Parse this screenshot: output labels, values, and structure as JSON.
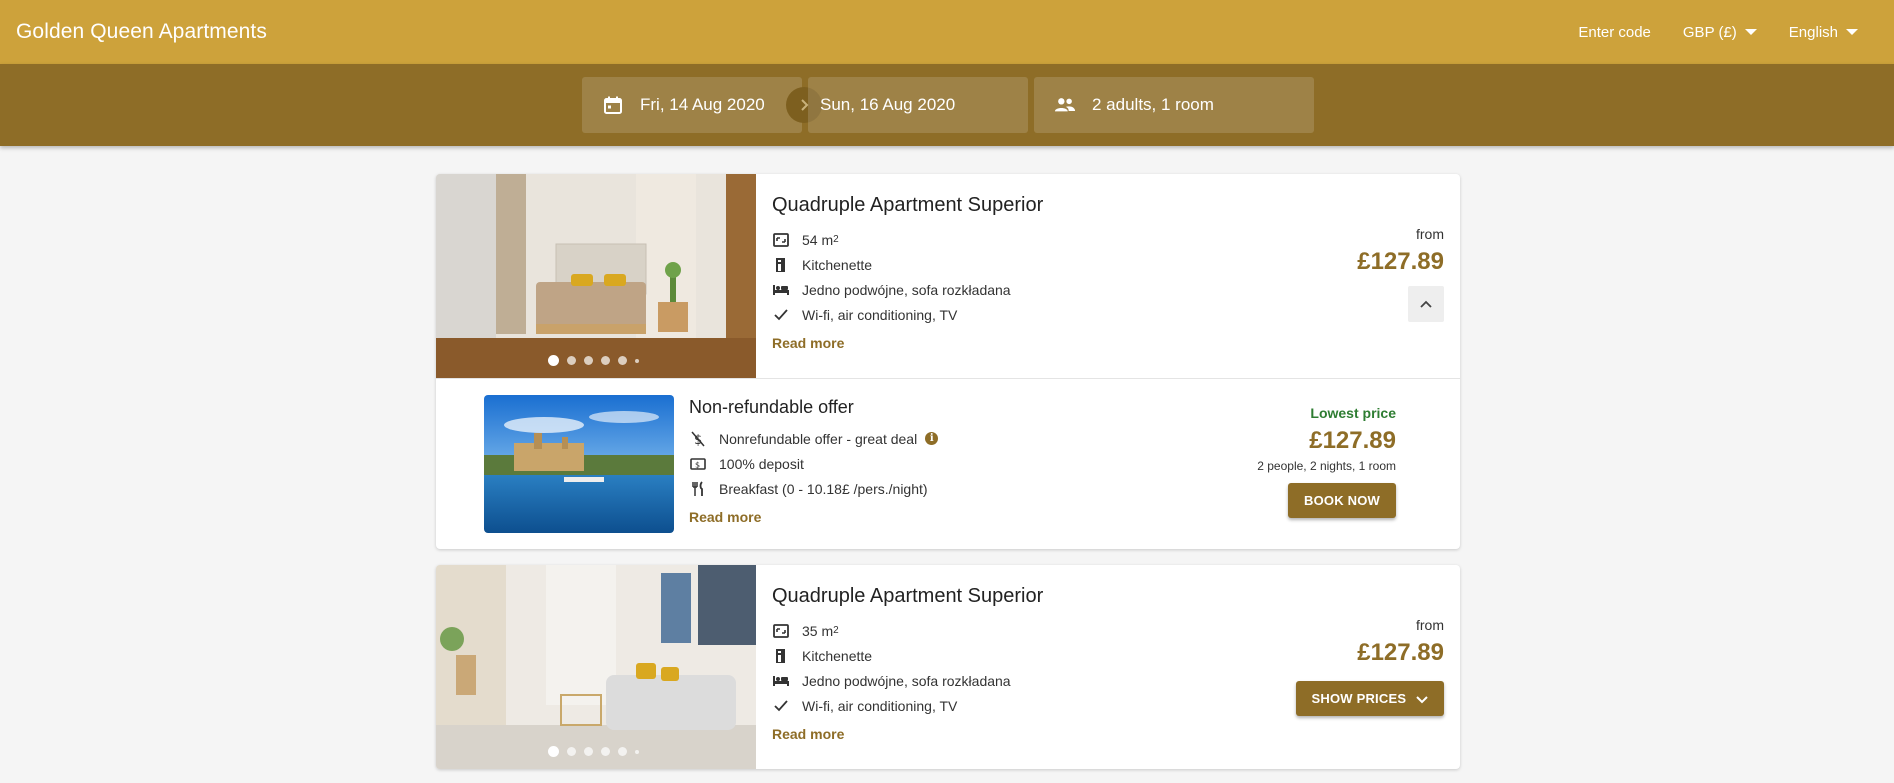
{
  "header": {
    "brand": "Golden Queen Apartments",
    "enter_code": "Enter code",
    "currency": "GBP (£)",
    "language": "English",
    "bg_color": "#cda23b"
  },
  "search": {
    "check_in": "Fri, 14 Aug 2020",
    "check_out": "Sun, 16 Aug 2020",
    "guests": "2 adults, 1 room",
    "bg_color": "#8e6d27"
  },
  "rooms": [
    {
      "title": "Quadruple Apartment Superior",
      "area": "54 m",
      "area_sup": "2",
      "kitchen": "Kitchenette",
      "beds": "Jedno podwójne, sofa rozkładana",
      "amenities": "Wi-fi, air conditioning, TV",
      "read_more": "Read more",
      "from_label": "from",
      "price": "£127.89",
      "expanded": true,
      "offer": {
        "title": "Non-refundable offer",
        "feature1": "Nonrefundable offer - great deal",
        "feature2": "100% deposit",
        "feature3": "Breakfast (0 - 10.18£ /pers./night)",
        "read_more": "Read more",
        "lowest_label": "Lowest price",
        "price": "£127.89",
        "occupancy": "2 people, 2 nights, 1 room",
        "button": "BOOK NOW"
      }
    },
    {
      "title": "Quadruple Apartment Superior",
      "area": "35 m",
      "area_sup": "2",
      "kitchen": "Kitchenette",
      "beds": "Jedno podwójne, sofa rozkładana",
      "amenities": "Wi-fi, air conditioning, TV",
      "read_more": "Read more",
      "from_label": "from",
      "price": "£127.89",
      "button": "SHOW PRICES"
    }
  ],
  "colors": {
    "accent": "#8e6d27",
    "lowest_price": "#2e7d32"
  }
}
